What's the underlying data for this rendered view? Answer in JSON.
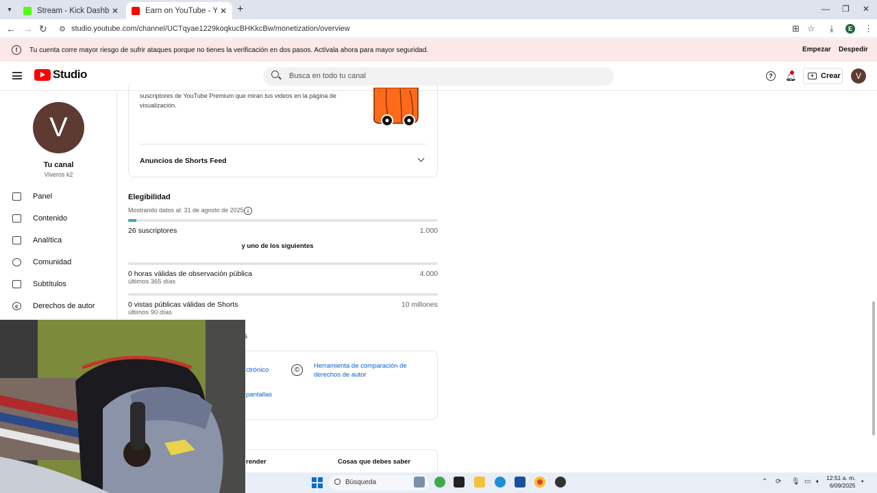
{
  "browser": {
    "tabs": [
      {
        "title": "Stream - Kick Dashboard",
        "favicon_color": "#53fc18"
      },
      {
        "title": "Earn on YouTube - YouTube Stu",
        "favicon_color": "#ff0000"
      }
    ],
    "url": "studio.youtube.com/channel/UCTqyae1229koqkucBHKkcBw/monetization/overview",
    "profile_initial": "E"
  },
  "security_banner": {
    "message": "Tu cuenta corre mayor riesgo de sufrir ataques porque no tienes la verificación en dos pasos. Actívala ahora para mayor seguridad.",
    "start_label": "Empezar",
    "dismiss_label": "Despedir"
  },
  "header": {
    "logo_text": "Studio",
    "search_placeholder": "Busca en todo tu canal",
    "create_label": "Crear",
    "avatar_initial": "V"
  },
  "sidebar": {
    "avatar_initial": "V",
    "channel_title": "Tu canal",
    "channel_name": "Viveros k2",
    "items": [
      {
        "label": "Panel",
        "icon": "dashboard-icon"
      },
      {
        "label": "Contenido",
        "icon": "content-icon"
      },
      {
        "label": "Analítica",
        "icon": "analytics-icon"
      },
      {
        "label": "Comunidad",
        "icon": "community-icon"
      },
      {
        "label": "Subtítulos",
        "icon": "subtitles-icon"
      },
      {
        "label": "Derechos de autor",
        "icon": "copyright-icon"
      }
    ]
  },
  "main": {
    "premium_text": "suscriptores de YouTube Premium que miran tus videos en la página de visualización.",
    "shorts_feed_label": "Anuncios de Shorts Feed",
    "eligibility": {
      "title": "Elegibilidad",
      "date_text": "Mostrando datos al: 31 de agosto de 2025",
      "subscribers_label": "26 suscriptores",
      "subscribers_target": "1.000",
      "subscribers_progress": 0.026,
      "one_of_text": "y uno de los siguientes",
      "watch_hours_label": "0 horas válidas de observación pública",
      "watch_hours_period": "últimos 365 días",
      "watch_hours_target": "4.000",
      "watch_hours_progress": 0,
      "shorts_views_label": "0 vistas públicas válidas de Shorts",
      "shorts_views_period": "últimos 90 días",
      "shorts_views_target": "10 millones",
      "shorts_views_progress": 0
    },
    "partial_heading_suffix": "s",
    "link_email_partial": "ctrónico",
    "link_screens_partial": "pantallas",
    "copyright_tool_link": "Herramienta de comparación de derechos de autor",
    "tab_learn_partial": "render",
    "tab_know": "Cosas que debes saber"
  },
  "taskbar": {
    "search_label": "Búsqueda",
    "time": "12:51 a. m.",
    "date": "6/09/2025"
  }
}
